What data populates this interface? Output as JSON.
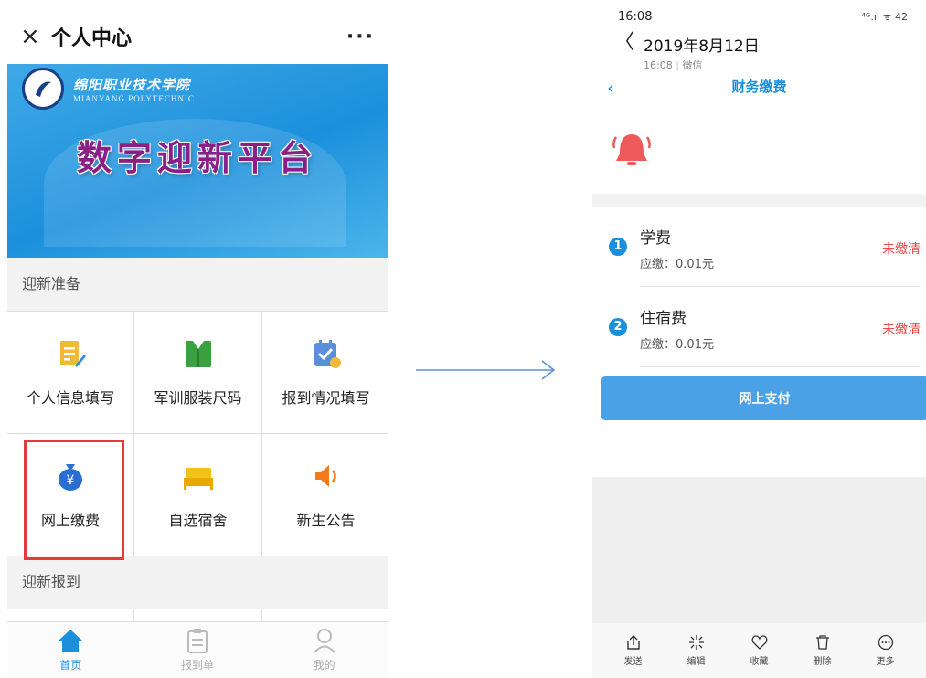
{
  "left_phone": {
    "topbar": {
      "close_glyph": "×",
      "title": "个人中心",
      "more_glyph": "···"
    },
    "banner": {
      "school_cn": "绵阳职业技术学院",
      "school_en": "MIANYANG POLYTECHNIC",
      "headline": "数字迎新平台"
    },
    "section1": {
      "title": "迎新准备"
    },
    "grid": [
      {
        "label": "个人信息填写",
        "icon": "form-edit-icon"
      },
      {
        "label": "军训服装尺码",
        "icon": "uniform-icon"
      },
      {
        "label": "报到情况填写",
        "icon": "checklist-icon"
      },
      {
        "label": "网上缴费",
        "icon": "money-bag-icon",
        "highlighted": true
      },
      {
        "label": "自选宿舍",
        "icon": "bed-icon"
      },
      {
        "label": "新生公告",
        "icon": "speaker-icon"
      }
    ],
    "section2": {
      "title": "迎新报到"
    },
    "tabbar": [
      {
        "label": "首页",
        "icon": "home-icon",
        "active": true
      },
      {
        "label": "报到单",
        "icon": "clipboard-icon",
        "active": false
      },
      {
        "label": "我的",
        "icon": "user-icon",
        "active": false
      }
    ]
  },
  "right_phone": {
    "status_bar": {
      "time": "16:08",
      "icons": "⁴ᴳ.ıl ᯤ 42"
    },
    "chat_header": {
      "back_glyph": "〈",
      "date": "2019年8月12日",
      "sub_time": "16:08",
      "sub_source": "微信"
    },
    "page_title": "财务缴费",
    "fees": [
      {
        "index": "1",
        "name": "学费",
        "due_label": "应缴",
        "due_value": "0.01元",
        "state": "未缴清"
      },
      {
        "index": "2",
        "name": "住宿费",
        "due_label": "应缴",
        "due_value": "0.01元",
        "state": "未缴清"
      }
    ],
    "pay_button": "网上支付",
    "actions": [
      {
        "label": "发送",
        "icon": "share-icon"
      },
      {
        "label": "编辑",
        "icon": "edit-sparkle-icon"
      },
      {
        "label": "收藏",
        "icon": "heart-icon"
      },
      {
        "label": "删除",
        "icon": "trash-icon"
      },
      {
        "label": "更多",
        "icon": "more-circle-icon"
      }
    ]
  },
  "colors": {
    "accent_blue": "#1a8fdc",
    "alert_red": "#e94b4b",
    "highlight_border": "#e23b3b",
    "banner_title": "#8a1f88"
  }
}
